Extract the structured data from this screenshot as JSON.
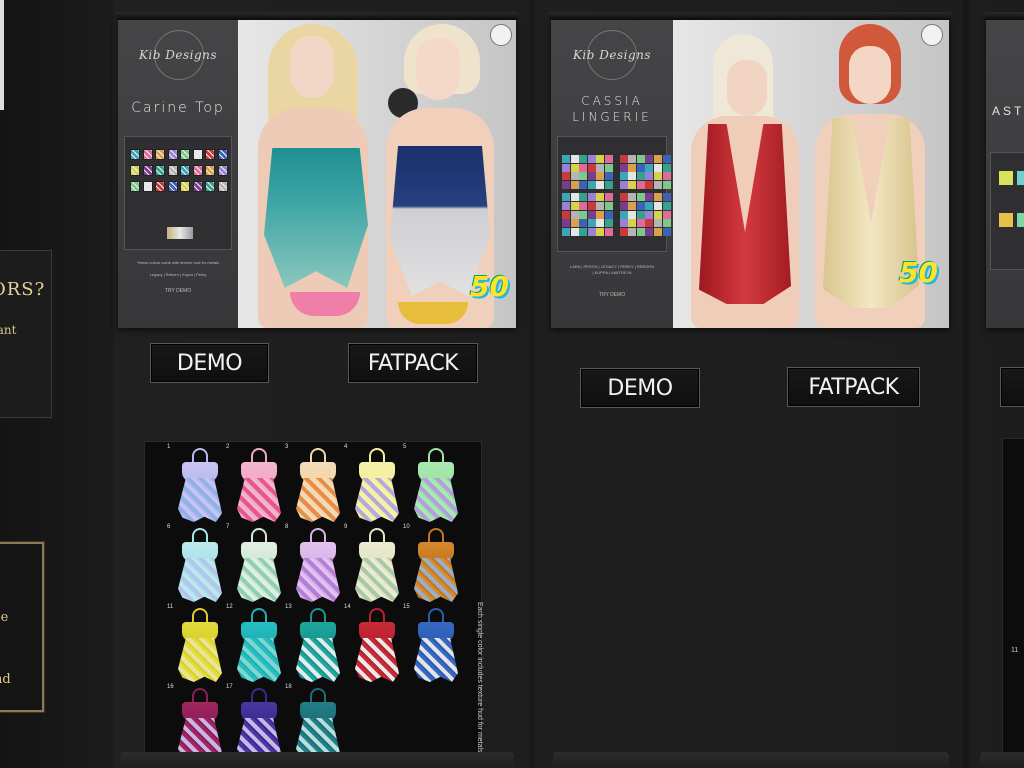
{
  "left_signs": {
    "question_fragment": "ORS?",
    "line_fragment": "rant",
    "frame_line_1": "se",
    "frame_line_2": "nd"
  },
  "poster_left": {
    "brand": "Kib Designs",
    "title": "Carine Top",
    "fine_print": "*these colors come with texture hud for metals",
    "sizes": "Legacy | Reborn | Kupra | Perky",
    "demo_note": "TRY DEMO",
    "badge": "50"
  },
  "poster_mid": {
    "brand": "Kib Designs",
    "title_line_1": "CASSIA",
    "title_line_2": "LINGERIE",
    "sizes": "LARA | PERITA | LEGACY | PERKY | REBORN | KUPRA | MAITREYA",
    "demo_note": "TRY DEMO",
    "badge": "50"
  },
  "poster_right": {
    "title_fragment": "AST"
  },
  "buttons": {
    "demo_left": "DEMO",
    "fatpack_left": "FATPACK",
    "demo_mid": "DEMO",
    "fatpack_mid": "FATPACK"
  },
  "color_board": {
    "note": "Each single color includes texture hud for metals",
    "items": [
      {
        "num": "1",
        "strap": "#b9b9ee",
        "top": "#c8c5f4",
        "base": "#8fb2e8"
      },
      {
        "num": "2",
        "strap": "#f1a9c6",
        "top": "#f4b6cf",
        "base": "#e5578c"
      },
      {
        "num": "3",
        "strap": "#f2d7a9",
        "top": "#f4dab8",
        "base": "#e78d4b"
      },
      {
        "num": "4",
        "strap": "#f2ef9c",
        "top": "#f6f1ab",
        "base": "#b6a7dc"
      },
      {
        "num": "5",
        "strap": "#9fe3a4",
        "top": "#a9e9b2",
        "base": "#b29ee0"
      },
      {
        "num": "6",
        "strap": "#a9e3e8",
        "top": "#bde9ee",
        "base": "#b5c4ec"
      },
      {
        "num": "7",
        "strap": "#d3e8d6",
        "top": "#e0efe3",
        "base": "#8fcfb2"
      },
      {
        "num": "8",
        "strap": "#d7b4e8",
        "top": "#e3c3ef",
        "base": "#b47ed6"
      },
      {
        "num": "9",
        "strap": "#e4e4c6",
        "top": "#ecebd4",
        "base": "#a8c9a8"
      },
      {
        "num": "10",
        "strap": "#c7741d",
        "top": "#d58a2b",
        "base": "#9ab0c8"
      },
      {
        "num": "11",
        "strap": "#d8cf2b",
        "top": "#e2dc3c",
        "base": "#e8e49a"
      },
      {
        "num": "12",
        "strap": "#1fb0b4",
        "top": "#24bfc2",
        "base": "#7fd7cf"
      },
      {
        "num": "13",
        "strap": "#17958e",
        "top": "#1fa89e",
        "base": "#e6ecee"
      },
      {
        "num": "14",
        "strap": "#b9222f",
        "top": "#c82b38",
        "base": "#eaeaea"
      },
      {
        "num": "15",
        "strap": "#2b5db4",
        "top": "#3769c3",
        "base": "#e4e4e6"
      },
      {
        "num": "16",
        "strap": "#8d1d55",
        "top": "#a1275f",
        "base": "#c8b6e8"
      },
      {
        "num": "17",
        "strap": "#3b2a8f",
        "top": "#4a37a3",
        "base": "#c9b6ea"
      },
      {
        "num": "18",
        "strap": "#1c6f78",
        "top": "#227f87",
        "base": "#b9dede"
      }
    ]
  },
  "colors": {
    "wall": "#1e1e1e",
    "poster_panel": "#3a3a3c",
    "button_bg": "#121212",
    "frame_gold": "#8d7a55",
    "badge_yellow": "#ffe22a",
    "badge_cyan": "#1fb7e3"
  }
}
